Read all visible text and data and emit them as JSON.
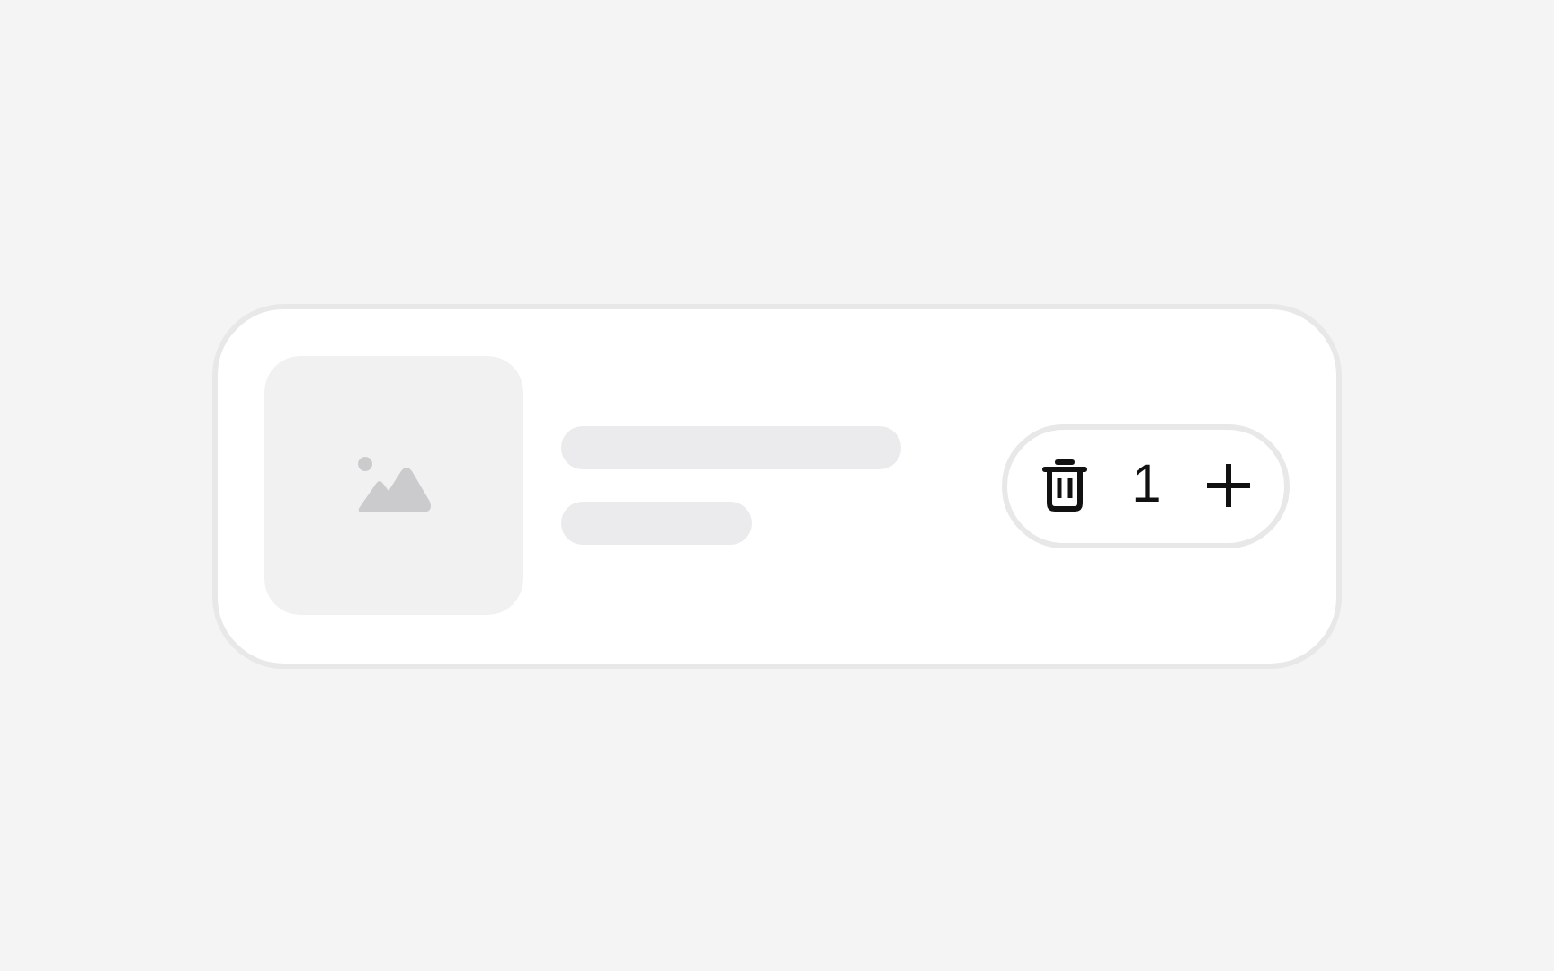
{
  "cart_item": {
    "quantity": "1"
  }
}
